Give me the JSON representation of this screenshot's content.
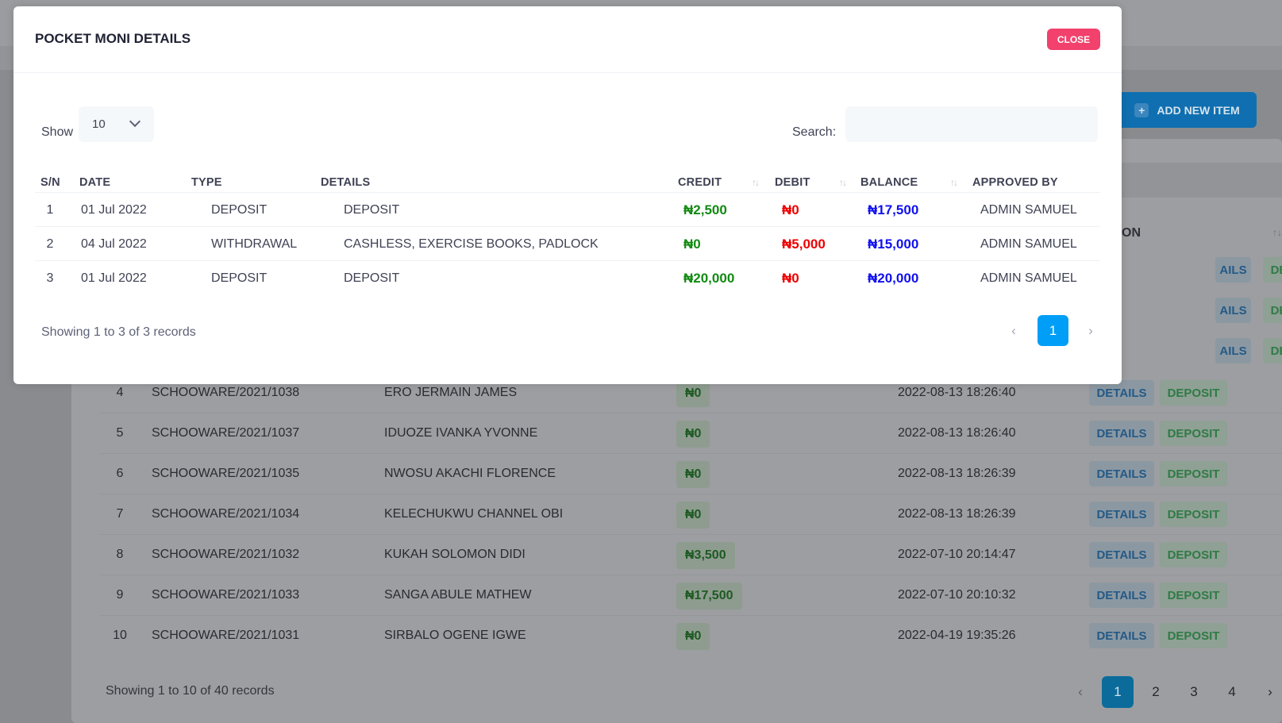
{
  "background": {
    "add_button_label": "ADD NEW ITEM",
    "action_header_partial": "ON",
    "rows": [
      {
        "sn": "4",
        "id": "SCHOOWARE/2021/1038",
        "name": "ERO JERMAIN JAMES",
        "balance": "₦0",
        "date": "2022-08-13 18:26:40"
      },
      {
        "sn": "5",
        "id": "SCHOOWARE/2021/1037",
        "name": "IDUOZE IVANKA YVONNE",
        "balance": "₦0",
        "date": "2022-08-13 18:26:40"
      },
      {
        "sn": "6",
        "id": "SCHOOWARE/2021/1035",
        "name": "NWOSU AKACHI FLORENCE",
        "balance": "₦0",
        "date": "2022-08-13 18:26:39"
      },
      {
        "sn": "7",
        "id": "SCHOOWARE/2021/1034",
        "name": "KELECHUKWU CHANNEL OBI",
        "balance": "₦0",
        "date": "2022-08-13 18:26:39"
      },
      {
        "sn": "8",
        "id": "SCHOOWARE/2021/1032",
        "name": "KUKAH SOLOMON DIDI",
        "balance": "₦3,500",
        "date": "2022-07-10 20:14:47"
      },
      {
        "sn": "9",
        "id": "SCHOOWARE/2021/1033",
        "name": "SANGA ABULE MATHEW",
        "balance": "₦17,500",
        "date": "2022-07-10 20:10:32"
      },
      {
        "sn": "10",
        "id": "SCHOOWARE/2021/1031",
        "name": "SIRBALO OGENE IGWE",
        "balance": "₦0",
        "date": "2022-04-19 19:35:26"
      }
    ],
    "hidden_row_actions": {
      "details_partial": "AILS",
      "deposit": "DEPOSIT"
    },
    "details_label": "DETAILS",
    "deposit_label": "DEPOSIT",
    "footer_text": "Showing 1 to 10 of 40 records",
    "pages": [
      "1",
      "2",
      "3",
      "4"
    ],
    "prev_icon": "‹",
    "next_icon": "›"
  },
  "modal": {
    "title": "POCKET MONI DETAILS",
    "close_label": "CLOSE",
    "show_label": "Show",
    "page_length": "10",
    "search_label": "Search:",
    "search_value": "",
    "columns": [
      "S/N",
      "DATE",
      "TYPE",
      "DETAILS",
      "CREDIT",
      "DEBIT",
      "BALANCE",
      "APPROVED BY"
    ],
    "rows": [
      {
        "sn": "1",
        "date": "01 Jul 2022",
        "type": "DEPOSIT",
        "details": "DEPOSIT",
        "credit": "₦2,500",
        "debit": "₦0",
        "balance": "₦17,500",
        "approved_by": "ADMIN SAMUEL"
      },
      {
        "sn": "2",
        "date": "04 Jul 2022",
        "type": "WITHDRAWAL",
        "details": "CASHLESS, EXERCISE BOOKS, PADLOCK",
        "credit": "₦0",
        "debit": "₦5,000",
        "balance": "₦15,000",
        "approved_by": "ADMIN SAMUEL"
      },
      {
        "sn": "3",
        "date": "01 Jul 2022",
        "type": "DEPOSIT",
        "details": "DEPOSIT",
        "credit": "₦20,000",
        "debit": "₦0",
        "balance": "₦20,000",
        "approved_by": "ADMIN SAMUEL"
      }
    ],
    "footer_text": "Showing 1 to 3 of 3 records",
    "current_page": "1",
    "prev_icon": "‹",
    "next_icon": "›",
    "colors": {
      "credit": "#128a12",
      "debit": "#ee0000",
      "balance": "#1010f0",
      "close": "#f1416c",
      "active_page": "#009ef7"
    }
  }
}
